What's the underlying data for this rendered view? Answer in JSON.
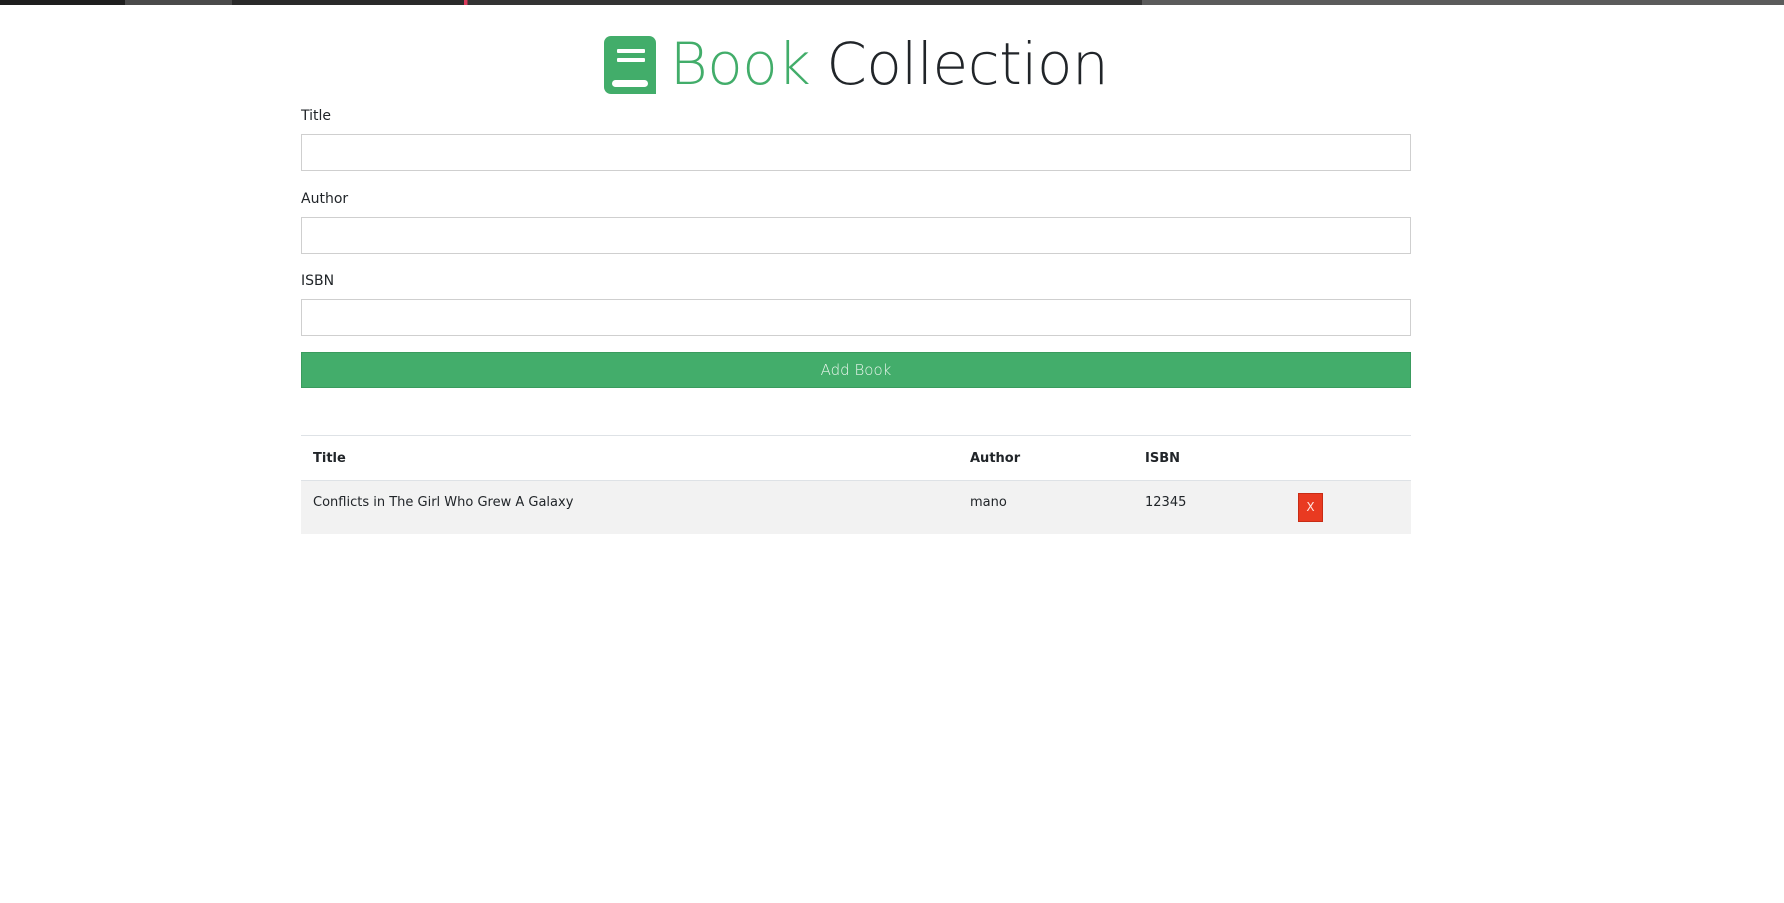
{
  "header": {
    "title_part1": "Book",
    "title_part2": "Collection",
    "icon": "book-icon"
  },
  "form": {
    "title_label": "Title",
    "title_value": "",
    "author_label": "Author",
    "author_value": "",
    "isbn_label": "ISBN",
    "isbn_value": "",
    "submit_label": "Add Book"
  },
  "table": {
    "headers": [
      "Title",
      "Author",
      "ISBN",
      ""
    ],
    "rows": [
      {
        "title": "Conflicts in The Girl Who Grew A Galaxy",
        "author": "mano",
        "isbn": "12345",
        "delete_label": "X"
      }
    ]
  },
  "colors": {
    "accent": "#42ad6a",
    "button": "#43ad6b",
    "delete": "#e93a21",
    "row_background": "#f2f2f2"
  }
}
